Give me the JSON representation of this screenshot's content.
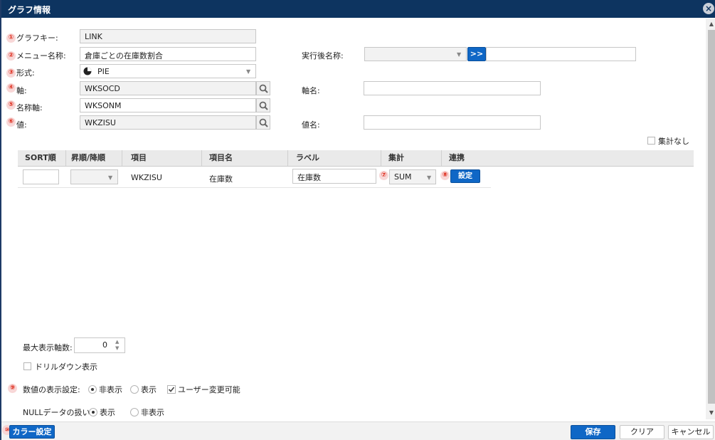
{
  "window": {
    "title": "グラフ情報"
  },
  "badges": [
    "①",
    "②",
    "③",
    "④",
    "⑤",
    "⑥",
    "⑦",
    "⑧",
    "⑨",
    "⑩"
  ],
  "form": {
    "graph_key": {
      "label": "グラフキー:",
      "value": "LINK"
    },
    "menu_name": {
      "label": "メニュー名称:",
      "value": "倉庫ごとの在庫数割合"
    },
    "post_exec_name": {
      "label": "実行後名称:",
      "select_value": "",
      "button": ">>",
      "value": ""
    },
    "format": {
      "label": "形式:",
      "value": "PIE",
      "icon": "pie-chart-icon"
    },
    "axis": {
      "label": "軸:",
      "value": "WKSOCD"
    },
    "axis_name": {
      "label": "軸名:",
      "value": ""
    },
    "name_axis": {
      "label": "名称軸:",
      "value": "WKSONM"
    },
    "value": {
      "label": "値:",
      "value": "WKZISU"
    },
    "value_name": {
      "label": "値名:",
      "value": ""
    }
  },
  "no_aggregation": {
    "label": "集計なし",
    "checked": false
  },
  "table": {
    "columns": [
      "SORT順",
      "昇順/降順",
      "項目",
      "項目名",
      "ラベル",
      "集計",
      "連携"
    ],
    "rows": [
      {
        "sort": "",
        "order": "",
        "item": "WKZISU",
        "item_name": "在庫数",
        "label": "在庫数",
        "aggregate": "SUM",
        "link_button": "設定"
      }
    ]
  },
  "max_axis": {
    "label": "最大表示軸数:",
    "value": "0"
  },
  "drilldown": {
    "label": "ドリルダウン表示",
    "checked": false
  },
  "value_display": {
    "label": "数値の表示設定:",
    "options": [
      "非表示",
      "表示"
    ],
    "selected": "非表示",
    "user_changeable": {
      "label": "ユーザー変更可能",
      "checked": true
    }
  },
  "null_handling": {
    "label": "NULLデータの扱い",
    "options": [
      "表示",
      "非表示"
    ],
    "selected": "表示"
  },
  "footer": {
    "color_button": "カラー設定",
    "save_button": "保存",
    "clear_button": "クリア",
    "cancel_button": "キャンセル"
  },
  "colors": {
    "titlebar": "#0d3460",
    "primary": "#0f67c6",
    "badge": "#d21"
  }
}
